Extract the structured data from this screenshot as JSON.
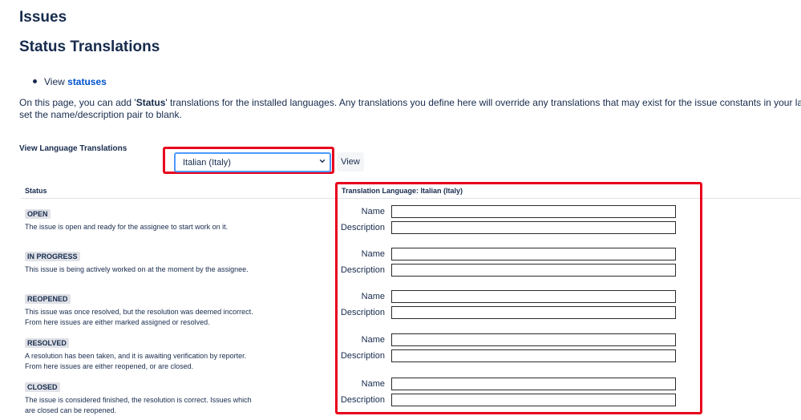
{
  "page": {
    "title": "Issues",
    "subtitle": "Status Translations",
    "bullet_prefix": "View",
    "bullet_link": "statuses",
    "intro_line1_a": "On this page, you can add '",
    "intro_line1_bold": "Status",
    "intro_line1_b": "' translations for the installed languages. Any translations you define here will override any translations that may exist for the issue constants in your languages resource b",
    "intro_line2": "set the name/description pair to blank."
  },
  "language": {
    "label": "View Language Translations",
    "selected": "Italian (Italy)",
    "view_button": "View"
  },
  "table": {
    "status_header": "Status",
    "translation_header": "Translation Language: Italian (Italy)",
    "name_label": "Name",
    "description_label": "Description",
    "rows": [
      {
        "status": "OPEN",
        "desc1": "The issue is open and ready for the assignee to start work on it.",
        "desc2": "",
        "name_value": "",
        "description_value": ""
      },
      {
        "status": "IN PROGRESS",
        "desc1": "This issue is being actively worked on at the moment by the assignee.",
        "desc2": "",
        "name_value": "",
        "description_value": ""
      },
      {
        "status": "REOPENED",
        "desc1": "This issue was once resolved, but the resolution was deemed incorrect.",
        "desc2": "From here issues are either marked assigned or resolved.",
        "name_value": "",
        "description_value": ""
      },
      {
        "status": "RESOLVED",
        "desc1": "A resolution has been taken, and it is awaiting verification by reporter.",
        "desc2": "From here issues are either reopened, or are closed.",
        "name_value": "",
        "description_value": ""
      },
      {
        "status": "CLOSED",
        "desc1": "The issue is considered finished, the resolution is correct. Issues which",
        "desc2": "are closed can be reopened.",
        "name_value": "",
        "description_value": ""
      }
    ]
  },
  "colors": {
    "highlight": "#e8001c",
    "link": "#0052cc",
    "text": "#172b4d"
  },
  "icons": {
    "select_chevron": "chevron-down-icon"
  }
}
